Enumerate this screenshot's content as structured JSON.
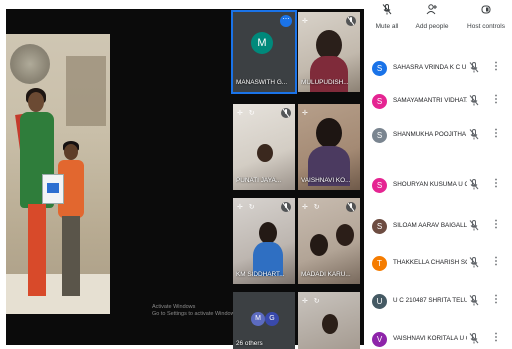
{
  "main": {
    "watermark_line1": "Activate Windows",
    "watermark_line2": "Go to Settings to activate Windows."
  },
  "tiles": [
    {
      "name": "MANASWITH G...",
      "initial": "M"
    },
    {
      "name": "MULUPUDISH..."
    },
    {
      "name": "PUNATI JAYA..."
    },
    {
      "name": "VAISHNAVI KO..."
    },
    {
      "name": "KM SIDDHART..."
    },
    {
      "name": "MADADI KARU..."
    },
    {
      "name": "26 others",
      "initials": [
        "M",
        "G"
      ]
    }
  ],
  "panel": {
    "actions": [
      {
        "label": "Mute all",
        "icon": "mic-off-icon"
      },
      {
        "label": "Add people",
        "icon": "add-person-icon"
      },
      {
        "label": "Host controls",
        "icon": "shield-lock-icon"
      }
    ],
    "participants": [
      {
        "initial": "S",
        "name": "SAHASRA VRINDA K C U...",
        "color": "#1a73e8"
      },
      {
        "initial": "S",
        "name": "SAMAYAMANTRI VIDHAT...",
        "color": "#e52592"
      },
      {
        "initial": "S",
        "name": "SHANMUKHA POOJITHA ...",
        "color": "#7a8590"
      },
      {
        "initial": "S",
        "name": "SHOURYAN KUSUMA U C...",
        "color": "#e52592"
      },
      {
        "initial": "S",
        "name": "SILOAM AARAV BAIGALL...",
        "color": "#6d4c41"
      },
      {
        "initial": "T",
        "name": "THAKKELLA CHARISH SO...",
        "color": "#f57c00"
      },
      {
        "initial": "U",
        "name": "U C 210487 SHRITA TELUK...",
        "color": "#455a64"
      },
      {
        "initial": "V",
        "name": "VAISHNAVI KORITALA U C...",
        "color": "#8e24aa"
      }
    ]
  }
}
